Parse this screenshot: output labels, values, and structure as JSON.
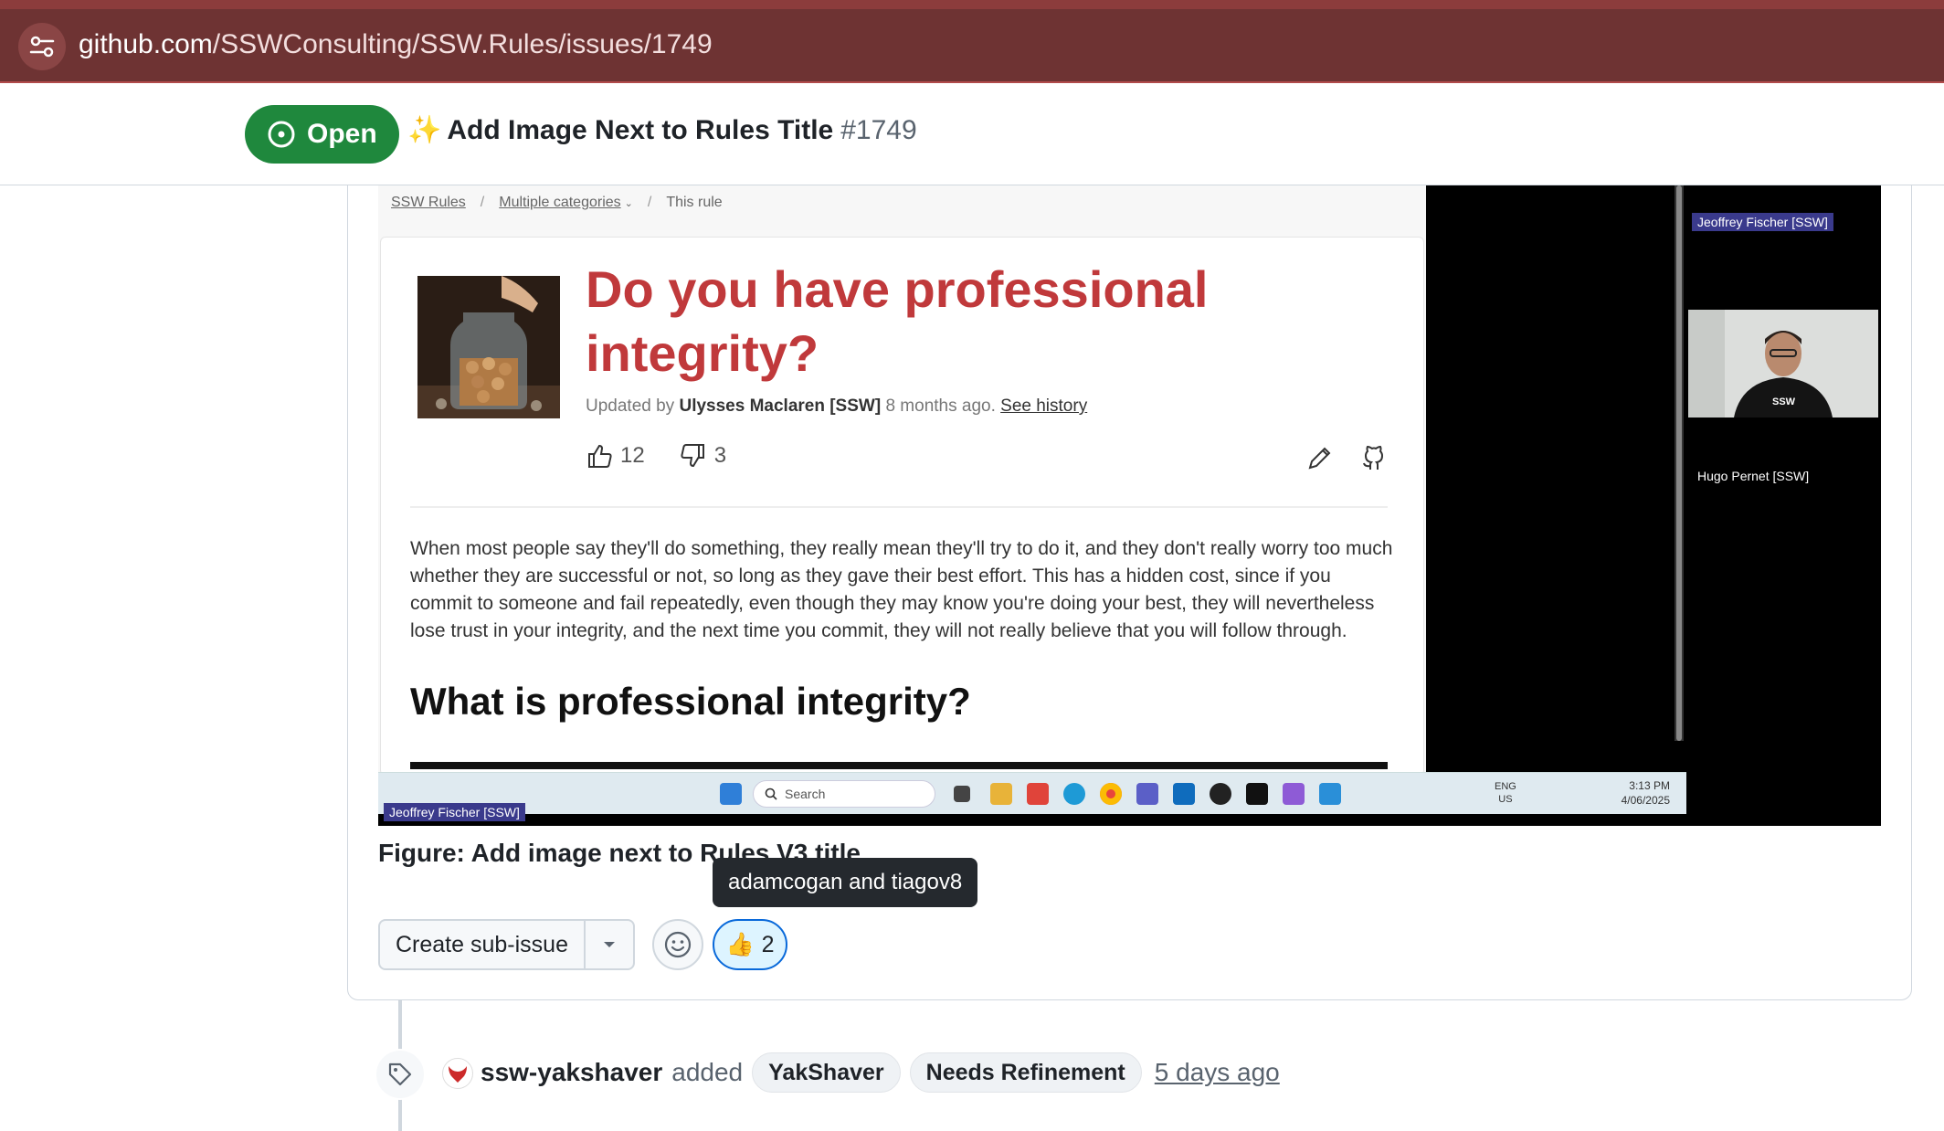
{
  "browser": {
    "url_domain": "github.com",
    "url_path": "/SSWConsulting/SSW.Rules/issues/1749",
    "site_info_icon": "tune-icon"
  },
  "issue": {
    "state": "Open",
    "title_emoji": "✨",
    "title": "Add Image Next to Rules Title",
    "number": "#1749",
    "colors": {
      "open_green": "#1f883d",
      "urlbar": "#6e3333"
    }
  },
  "screenshot": {
    "breadcrumbs": [
      "SSW Rules",
      "Multiple categories",
      "This rule"
    ],
    "rule_title": "Do you have professional integrity?",
    "meta_prefix": "Updated by",
    "meta_author": "Ulysses Maclaren [SSW]",
    "meta_age": "8 months ago.",
    "meta_history": "See history",
    "upvotes": "12",
    "downvotes": "3",
    "body": "When most people say they'll do something, they really mean they'll try to do it, and they don't really worry too much whether they are successful or not, so long as they gave their best effort. This has a hidden cost, since if you commit to someone and fail repeatedly, even though they may know you're doing your best, they will nevertheless lose trust in your integrity, and the next time you commit, they will not really believe that you will follow through.",
    "subheading": "What is professional integrity?",
    "presenter_tag_top": "Jeoffrey Fischer [SSW]",
    "presenter_tag_bottom": "Jeoffrey Fischer [SSW]",
    "participant_name": "Hugo Pernet [SSW]",
    "taskbar": {
      "search_placeholder": "Search",
      "lang_1": "ENG",
      "lang_2": "US",
      "time": "3:13 PM",
      "date": "4/06/2025"
    },
    "colors": {
      "rule_title_red": "#c0393b"
    }
  },
  "figure_caption": "Figure: Add image next to Rules V3 title",
  "tooltip": "adamcogan and tiagov8",
  "actions": {
    "create_sub_issue": "Create sub-issue",
    "reaction_emoji": "👍",
    "reaction_count": "2"
  },
  "timeline": {
    "actor": "ssw-yakshaver",
    "verb": "added",
    "labels": [
      "YakShaver",
      "Needs Refinement"
    ],
    "time": "5 days ago"
  }
}
